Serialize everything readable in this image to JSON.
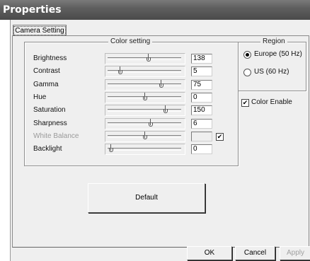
{
  "window": {
    "title": "Properties"
  },
  "tabs": [
    {
      "label": "Camera Setting"
    }
  ],
  "color_setting": {
    "legend": "Color setting",
    "rows": [
      {
        "label": "Brightness",
        "value": "138",
        "level": 0.55
      },
      {
        "label": "Contrast",
        "value": "5",
        "level": 0.16
      },
      {
        "label": "Gamma",
        "value": "75",
        "level": 0.72
      },
      {
        "label": "Hue",
        "value": "0",
        "level": 0.5
      },
      {
        "label": "Saturation",
        "value": "150",
        "level": 0.78
      },
      {
        "label": "Sharpness",
        "value": "6",
        "level": 0.58
      },
      {
        "label": "White Balance",
        "value": "",
        "level": 0.5,
        "disabled": true,
        "auto_checked": true,
        "auto_mark": "✔"
      },
      {
        "label": "Backlight",
        "value": "0",
        "level": 0.04
      }
    ]
  },
  "region": {
    "legend": "Region",
    "options": [
      {
        "label": "Europe (50 Hz)",
        "selected": true
      },
      {
        "label": "US (60 Hz)",
        "selected": false
      }
    ]
  },
  "color_enable": {
    "label": "Color Enable",
    "checked": true,
    "mark": "✔"
  },
  "buttons": {
    "default": "Default",
    "ok": "OK",
    "cancel": "Cancel",
    "apply": "Apply"
  }
}
